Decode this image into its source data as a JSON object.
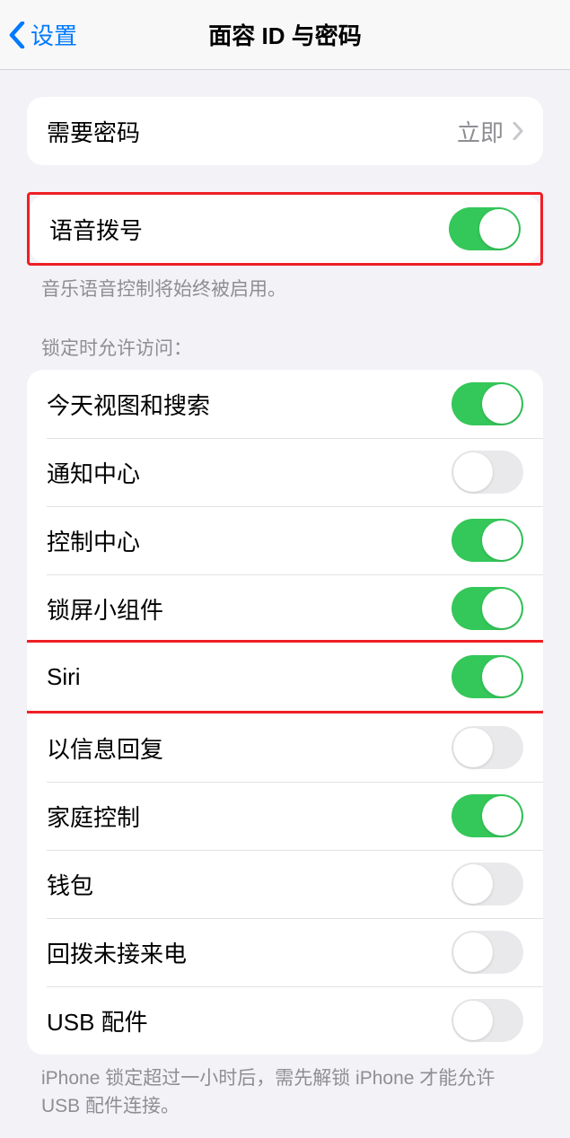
{
  "navbar": {
    "back_label": "设置",
    "title": "面容 ID 与密码"
  },
  "passcode_row": {
    "label": "需要密码",
    "value": "立即"
  },
  "voice_dial": {
    "label": "语音拨号",
    "footer": "音乐语音控制将始终被启用。",
    "on": true
  },
  "lock_section": {
    "header": "锁定时允许访问：",
    "items": [
      {
        "label": "今天视图和搜索",
        "on": true
      },
      {
        "label": "通知中心",
        "on": false
      },
      {
        "label": "控制中心",
        "on": true
      },
      {
        "label": "锁屏小组件",
        "on": true
      },
      {
        "label": "Siri",
        "on": true
      },
      {
        "label": "以信息回复",
        "on": false
      },
      {
        "label": "家庭控制",
        "on": true
      },
      {
        "label": "钱包",
        "on": false
      },
      {
        "label": "回拨未接来电",
        "on": false
      },
      {
        "label": "USB 配件",
        "on": false
      }
    ],
    "footer": "iPhone 锁定超过一小时后，需先解锁 iPhone 才能允许 USB 配件连接。"
  }
}
